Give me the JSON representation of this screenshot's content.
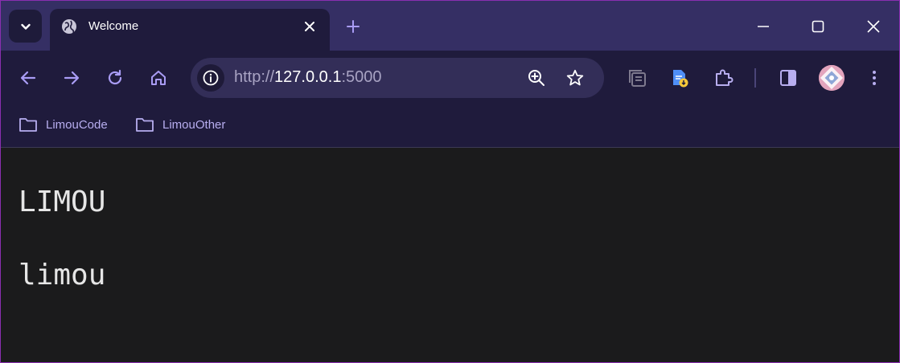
{
  "browser": {
    "tab": {
      "title": "Welcome"
    },
    "omnibox": {
      "scheme": "http://",
      "host": "127.0.0.1",
      "port": ":5000"
    },
    "bookmarks": [
      {
        "label": "LimouCode",
        "icon": "folder-icon"
      },
      {
        "label": "LimouOther",
        "icon": "folder-icon"
      }
    ],
    "colors": {
      "accent": "#a99cf5",
      "tabstrip": "#352f64",
      "toolbar": "#1f1b3c",
      "content_bg": "#1b1b1c"
    }
  },
  "page": {
    "heading_upper": "LIMOU",
    "heading_lower": "limou"
  }
}
